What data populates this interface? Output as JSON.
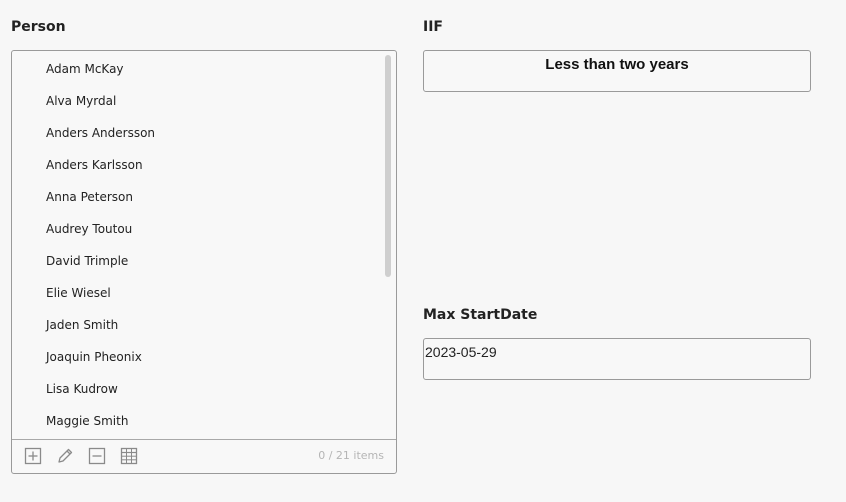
{
  "person": {
    "label": "Person",
    "items": [
      "Adam McKay",
      "Alva Myrdal",
      "Anders Andersson",
      "Anders Karlsson",
      "Anna Peterson",
      "Audrey Toutou",
      "David Trimple",
      "Elie Wiesel",
      "Jaden Smith",
      "Joaquin Pheonix",
      "Lisa Kudrow",
      "Maggie Smith"
    ],
    "count_text": "0 / 21 items",
    "tools": [
      "add-icon",
      "edit-icon",
      "remove-icon",
      "table-icon"
    ]
  },
  "iif": {
    "label": "IIF",
    "value": "Less than two years"
  },
  "max_startdate": {
    "label": "Max StartDate",
    "value": "2023-05-29"
  }
}
